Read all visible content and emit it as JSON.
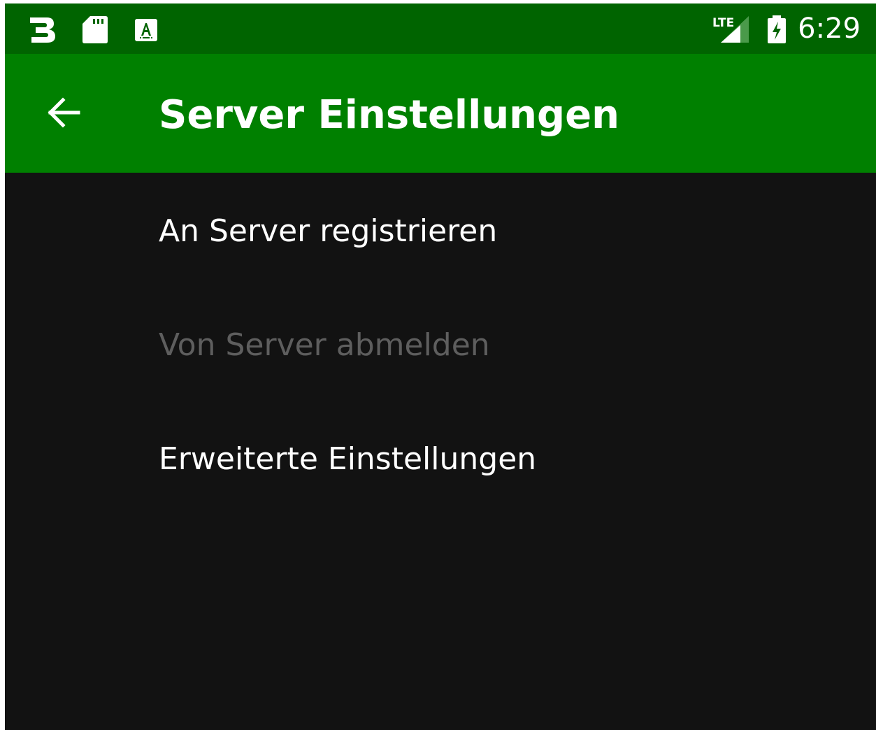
{
  "status_bar": {
    "time": "6:29",
    "icons": [
      "app-b-icon",
      "sd-card-icon",
      "keyboard-a-icon",
      "lte-signal-icon",
      "battery-charging-icon"
    ],
    "background": "#006400"
  },
  "toolbar": {
    "title": "Server Einstellungen",
    "back_icon": "arrow-back-icon",
    "background": "#008000"
  },
  "menu": {
    "items": [
      {
        "label": "An Server registrieren",
        "enabled": true
      },
      {
        "label": "Von Server abmelden",
        "enabled": false
      },
      {
        "label": "Erweiterte Einstellungen",
        "enabled": true
      }
    ]
  },
  "colors": {
    "content_background": "#121212",
    "text_primary": "#ffffff",
    "text_disabled": "#5e5e5e"
  }
}
